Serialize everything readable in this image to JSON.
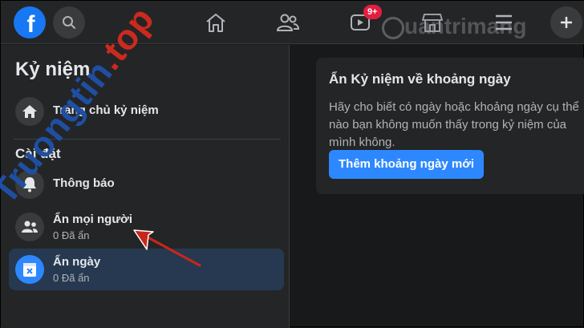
{
  "header": {
    "logo_letter": "f",
    "notification_badge": "9+",
    "watermark": "uantrimang",
    "icons": [
      "facebook-logo",
      "search-icon",
      "home-icon",
      "friends-icon",
      "watch-icon",
      "marketplace-icon",
      "menu-icon",
      "plus-icon"
    ]
  },
  "sidebar": {
    "title": "Kỷ niệm",
    "home_item": {
      "label": "Trang chủ kỷ niệm"
    },
    "section_label": "Cài đặt",
    "items": [
      {
        "label": "Thông báo",
        "sub": ""
      },
      {
        "label": "Ẩn mọi người",
        "sub": "0 Đã ẩn"
      },
      {
        "label": "Ẩn ngày",
        "sub": "0 Đã ẩn"
      }
    ]
  },
  "card": {
    "title": "Ẩn Kỷ niệm về khoảng ngày",
    "description": "Hãy cho biết có ngày hoặc khoảng ngày cụ thể nào bạn không muốn thấy trong kỷ niệm của mình không.",
    "button_label": "Thêm khoảng ngày mới"
  },
  "watermark_diagonal": {
    "text": "Truongtin",
    "dot": ".",
    "suffix": "top"
  },
  "colors": {
    "accent": "#2d88ff",
    "badge": "#e41e3f",
    "surface": "#242526",
    "background": "#18191a",
    "active_item": "#263951"
  }
}
